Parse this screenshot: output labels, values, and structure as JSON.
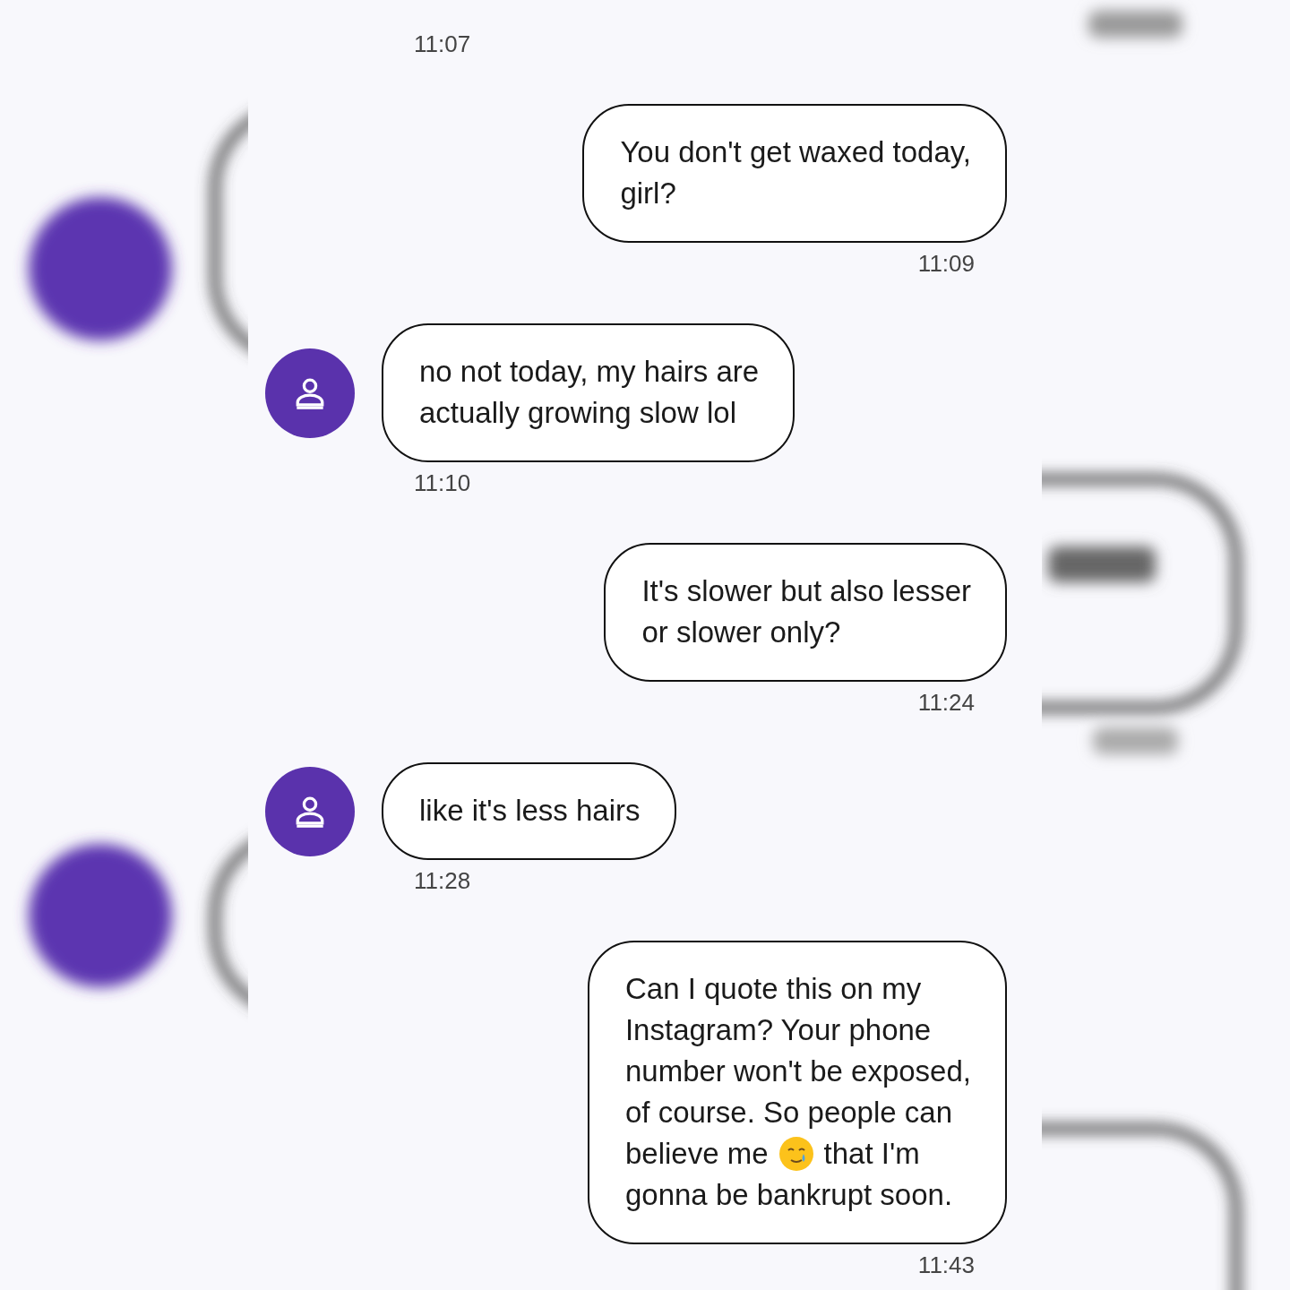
{
  "conversation": {
    "leading_timestamp": "11:07",
    "messages": [
      {
        "outgoing": true,
        "lines": [
          [
            {
              "kind": "text",
              "text": "You don't get waxed today,"
            }
          ],
          [
            {
              "kind": "text",
              "text": "girl?"
            }
          ]
        ],
        "time": "11:09"
      },
      {
        "outgoing": false,
        "lines": [
          [
            {
              "kind": "text",
              "text": "no not today, my hairs are"
            }
          ],
          [
            {
              "kind": "text",
              "text": "actually growing slow lol"
            }
          ]
        ],
        "time": "11:10"
      },
      {
        "outgoing": true,
        "lines": [
          [
            {
              "kind": "text",
              "text": "It's slower but also lesser"
            }
          ],
          [
            {
              "kind": "text",
              "text": "or slower only?"
            }
          ]
        ],
        "time": "11:24"
      },
      {
        "outgoing": false,
        "lines": [
          [
            {
              "kind": "text",
              "text": "like it's less hairs"
            }
          ]
        ],
        "time": "11:28"
      },
      {
        "outgoing": true,
        "lines": [
          [
            {
              "kind": "text",
              "text": "Can I quote this on my"
            }
          ],
          [
            {
              "kind": "text",
              "text": "Instagram? Your phone"
            }
          ],
          [
            {
              "kind": "text",
              "text": "number won't be exposed,"
            }
          ],
          [
            {
              "kind": "text",
              "text": "of course. So people can"
            }
          ],
          [
            {
              "kind": "text",
              "text": "believe me"
            },
            {
              "kind": "emoji"
            },
            {
              "kind": "text",
              "text": "that I'm"
            }
          ],
          [
            {
              "kind": "text",
              "text": "gonna be bankrupt soon."
            }
          ]
        ],
        "time": "11:43"
      }
    ]
  }
}
